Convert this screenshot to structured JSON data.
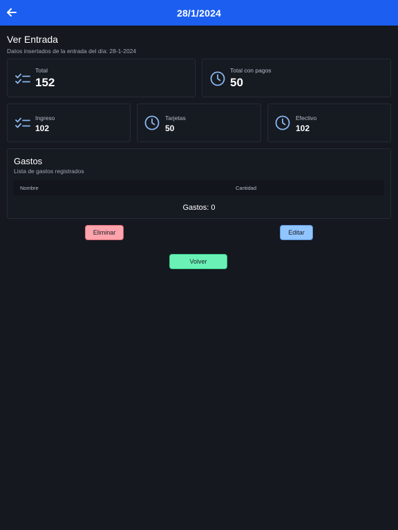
{
  "topbar": {
    "title": "28/1/2024",
    "back_icon": "arrow-left-icon"
  },
  "header": {
    "title": "Ver Entrada",
    "subtitle": "Datos insertados de la entrada del día: 28-1-2024"
  },
  "stats_top": [
    {
      "label": "Total",
      "value": "152",
      "icon": "checklist-icon"
    },
    {
      "label": "Total con pagos",
      "value": "50",
      "icon": "clock-icon"
    }
  ],
  "stats_bottom": [
    {
      "label": "Ingreso",
      "value": "102",
      "icon": "checklist-icon"
    },
    {
      "label": "Tarjetas",
      "value": "50",
      "icon": "clock-icon"
    },
    {
      "label": "Efectivo",
      "value": "102",
      "icon": "clock-icon"
    }
  ],
  "gastos": {
    "title": "Gastos",
    "subtitle": "Lista de gastos registrados",
    "columns": [
      "Nombre",
      "Cantidad"
    ],
    "count_text": "Gastos: 0"
  },
  "actions": {
    "eliminar": "Eliminar",
    "editar": "Editar",
    "volver": "Volver"
  },
  "colors": {
    "appbar": "#1c5ef0",
    "background": "#15181f",
    "icon_accent": "#8ab8f2",
    "eliminar": "#ffa4ad",
    "editar": "#90c5ff",
    "volver": "#6af2b6"
  }
}
